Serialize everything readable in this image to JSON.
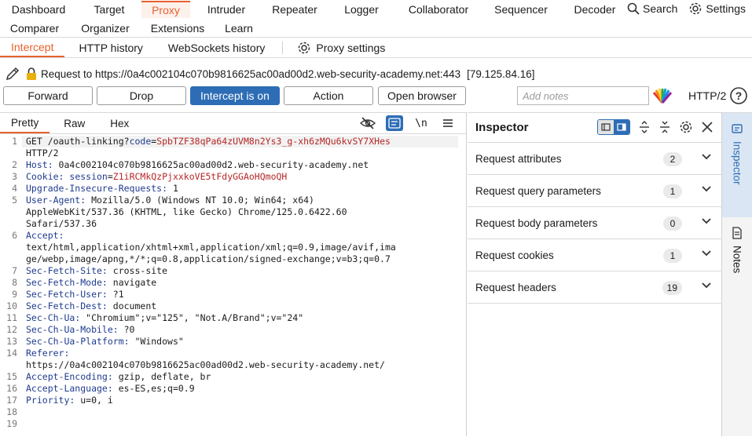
{
  "nav": {
    "row1": [
      "Dashboard",
      "Target",
      "Proxy",
      "Intruder",
      "Repeater",
      "Logger",
      "Collaborator",
      "Sequencer",
      "Decoder"
    ],
    "row2": [
      "Comparer",
      "Organizer",
      "Extensions",
      "Learn"
    ],
    "active": "Proxy",
    "search_label": "Search",
    "settings_label": "Settings"
  },
  "subtabs": {
    "intercept": "Intercept",
    "http_history": "HTTP history",
    "websockets_history": "WebSockets history",
    "proxy_settings": "Proxy settings"
  },
  "request": {
    "label": "Request to https://0a4c002104c070b9816625ac00ad00d2.web-security-academy.net:443",
    "ip": "[79.125.84.16]"
  },
  "toolbar": {
    "forward": "Forward",
    "drop": "Drop",
    "intercept": "Intercept is on",
    "action": "Action",
    "open_browser": "Open browser",
    "notes_placeholder": "Add notes",
    "http_version": "HTTP/2"
  },
  "editor": {
    "tabs": [
      "Pretty",
      "Raw",
      "Hex"
    ],
    "active_tab": "Pretty",
    "newline_tool": "\\n",
    "lines": {
      "l1_method": "GET /oauth-linking?",
      "l1_param": "code",
      "l1_eq": "=",
      "l1_value": "SpbTZF38qPa64zUVM8n2Ys3_g-xh6zMQu6kvSY7XHes",
      "l1_proto": "HTTP/2",
      "l2_name": "Host:",
      "l2_value": " 0a4c002104c070b9816625ac00ad00d2.web-security-academy.net",
      "l3_name": "Cookie:",
      "l3_cname": " session",
      "l3_eq": "=",
      "l3_cval": "Z1iRCMkQzPjxxkoVE5tFdyGGAoHQmoQH",
      "l4_name": "Upgrade-Insecure-Requests:",
      "l4_value": " 1",
      "l5_name": "User-Agent:",
      "l5_value": " Mozilla/5.0 (Windows NT 10.0; Win64; x64)",
      "l5_cont1": "AppleWebKit/537.36 (KHTML, like Gecko) Chrome/125.0.6422.60",
      "l5_cont2": "Safari/537.36",
      "l6_name": "Accept:",
      "l6_cont1": "text/html,application/xhtml+xml,application/xml;q=0.9,image/avif,ima",
      "l6_cont2": "ge/webp,image/apng,*/*;q=0.8,application/signed-exchange;v=b3;q=0.7",
      "l7_name": "Sec-Fetch-Site:",
      "l7_value": " cross-site",
      "l8_name": "Sec-Fetch-Mode:",
      "l8_value": " navigate",
      "l9_name": "Sec-Fetch-User:",
      "l9_value": " ?1",
      "l10_name": "Sec-Fetch-Dest:",
      "l10_value": " document",
      "l11_name": "Sec-Ch-Ua:",
      "l11_value": " \"Chromium\";v=\"125\", \"Not.A/Brand\";v=\"24\"",
      "l12_name": "Sec-Ch-Ua-Mobile:",
      "l12_value": " ?0",
      "l13_name": "Sec-Ch-Ua-Platform:",
      "l13_value": " \"Windows\"",
      "l14_name": "Referer:",
      "l14_cont1": "https://0a4c002104c070b9816625ac00ad00d2.web-security-academy.net/",
      "l15_name": "Accept-Encoding:",
      "l15_value": " gzip, deflate, br",
      "l16_name": "Accept-Language:",
      "l16_value": " es-ES,es;q=0.9",
      "l17_name": "Priority:",
      "l17_value": " u=0, i"
    },
    "line_numbers": [
      "1",
      "2",
      "3",
      "4",
      "5",
      "6",
      "7",
      "8",
      "9",
      "10",
      "11",
      "12",
      "13",
      "14",
      "15",
      "16",
      "17",
      "18",
      "19"
    ]
  },
  "inspector": {
    "title": "Inspector",
    "rows": [
      {
        "label": "Request attributes",
        "count": "2"
      },
      {
        "label": "Request query parameters",
        "count": "1"
      },
      {
        "label": "Request body parameters",
        "count": "0"
      },
      {
        "label": "Request cookies",
        "count": "1"
      },
      {
        "label": "Request headers",
        "count": "19"
      }
    ]
  },
  "rail": {
    "inspector": "Inspector",
    "notes": "Notes"
  },
  "colors": {
    "accent": "#e8612c",
    "primary": "#2d6db5",
    "header_name": "#1f3b8f",
    "value_red": "#b52727"
  }
}
